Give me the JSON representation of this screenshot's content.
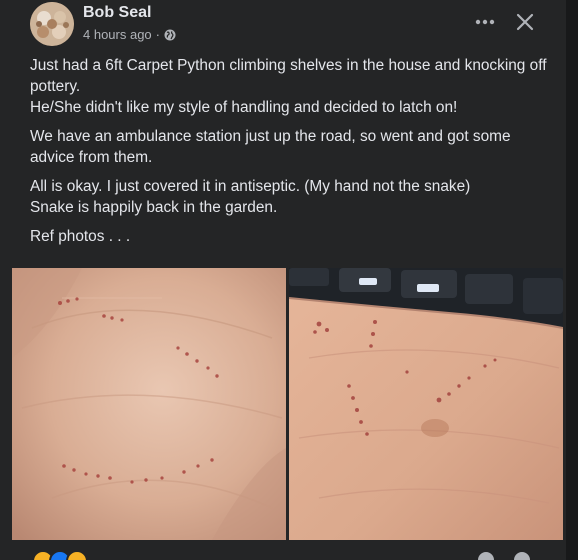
{
  "post": {
    "author": "Bob Seal",
    "timestamp": "4 hours ago",
    "separator": "·",
    "privacy_icon": "globe-icon",
    "paragraphs": [
      "Just had a 6ft Carpet Python climbing shelves in the house and knocking off pottery.\nHe/She didn't like my style of handling and decided to latch on!",
      "We have an ambulance station just up the road, so went and got some advice from them.",
      "All is okay. I just covered it in antiseptic. (My hand not the snake)\nSnake is happily back in the garden.",
      "Ref photos . . ."
    ],
    "photos": [
      "hand-bite-photo-1",
      "hand-bite-photo-2"
    ],
    "reactions": [
      "care",
      "like",
      "haha"
    ]
  },
  "icons": {
    "more": "more-options-icon",
    "close": "close-icon"
  },
  "colors": {
    "background": "#18191a",
    "card": "#242526",
    "text_primary": "#e4e6eb",
    "text_secondary": "#b0b3b8",
    "accent": "#1877f2"
  }
}
